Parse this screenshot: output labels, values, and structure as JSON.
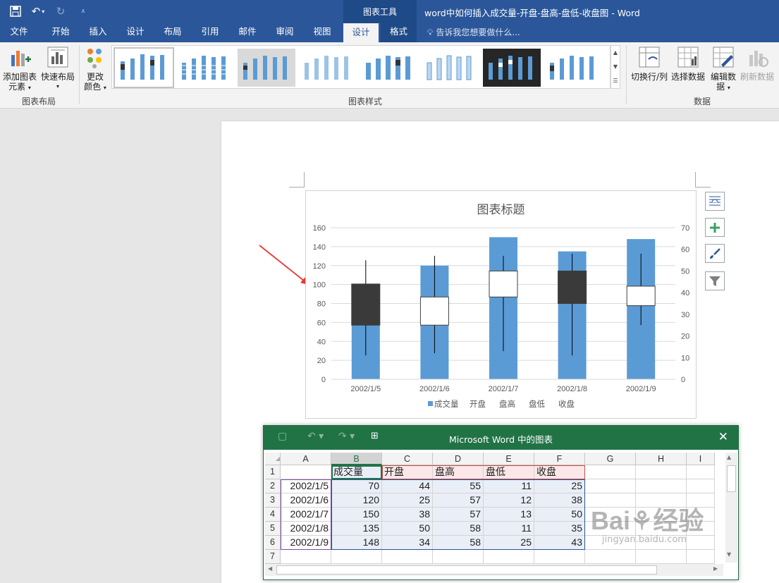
{
  "titlebar": {
    "context_group": "图表工具",
    "document_title": "word中如何插入成交量-开盘-盘高-盘低-收盘图 - Word"
  },
  "tabs": [
    "文件",
    "开始",
    "插入",
    "设计",
    "布局",
    "引用",
    "邮件",
    "审阅",
    "视图",
    "设计",
    "格式"
  ],
  "active_tab_index": 9,
  "tell_me": "告诉我您想要做什么...",
  "ribbon": {
    "add_element_l1": "添加图表",
    "add_element_l2": "元素",
    "quick_layout": "快速布局",
    "change_colors_l1": "更改",
    "change_colors_l2": "颜色",
    "group_layout": "图表布局",
    "group_styles": "图表样式",
    "switch_row_col": "切换行/列",
    "select_data": "选择数据",
    "edit_data_l1": "编辑数",
    "edit_data_l2": "据",
    "refresh_data": "刷新数据",
    "group_data": "数据",
    "colors": {
      "accent": "#2b579a",
      "excel": "#217346",
      "bar": "#5b9bd5",
      "down_box": "#3a3a3a"
    }
  },
  "chart_data": {
    "type": "bar",
    "title": "图表标题",
    "categories": [
      "2002/1/5",
      "2002/1/6",
      "2002/1/7",
      "2002/1/8",
      "2002/1/9"
    ],
    "primary_axis": {
      "min": 0,
      "max": 160,
      "step": 20,
      "ticks": [
        "0",
        "20",
        "40",
        "60",
        "80",
        "100",
        "120",
        "140",
        "160"
      ]
    },
    "secondary_axis": {
      "min": 0,
      "max": 70,
      "step": 10,
      "ticks": [
        "0",
        "10",
        "20",
        "30",
        "40",
        "50",
        "60",
        "70"
      ]
    },
    "series": [
      {
        "name": "成交量",
        "axis": "primary",
        "values": [
          70,
          120,
          150,
          135,
          148
        ]
      },
      {
        "name": "开盘",
        "axis": "secondary",
        "values": [
          44,
          25,
          38,
          50,
          34
        ]
      },
      {
        "name": "盘高",
        "axis": "secondary",
        "values": [
          55,
          57,
          57,
          58,
          58
        ]
      },
      {
        "name": "盘低",
        "axis": "secondary",
        "values": [
          11,
          12,
          13,
          11,
          25
        ]
      },
      {
        "name": "收盘",
        "axis": "secondary",
        "values": [
          25,
          38,
          50,
          35,
          43
        ]
      }
    ],
    "legend_position": "bottom",
    "gridlines": true
  },
  "excel": {
    "title": "Microsoft Word 中的图表",
    "columns": [
      "A",
      "B",
      "C",
      "D",
      "E",
      "F",
      "G",
      "H",
      "I"
    ],
    "rows": [
      "1",
      "2",
      "3",
      "4",
      "5",
      "6",
      "7"
    ],
    "header_row": [
      "",
      "成交量",
      "开盘",
      "盘高",
      "盘低",
      "收盘"
    ],
    "data_rows": [
      [
        "2002/1/5",
        "70",
        "44",
        "55",
        "11",
        "25"
      ],
      [
        "2002/1/6",
        "120",
        "25",
        "57",
        "12",
        "38"
      ],
      [
        "2002/1/7",
        "150",
        "38",
        "57",
        "13",
        "50"
      ],
      [
        "2002/1/8",
        "135",
        "50",
        "58",
        "11",
        "35"
      ],
      [
        "2002/1/9",
        "148",
        "34",
        "58",
        "25",
        "43"
      ]
    ]
  },
  "watermark": {
    "brand": "Bai",
    "brand2": "经验",
    "url": "jingyan.baidu.com"
  }
}
